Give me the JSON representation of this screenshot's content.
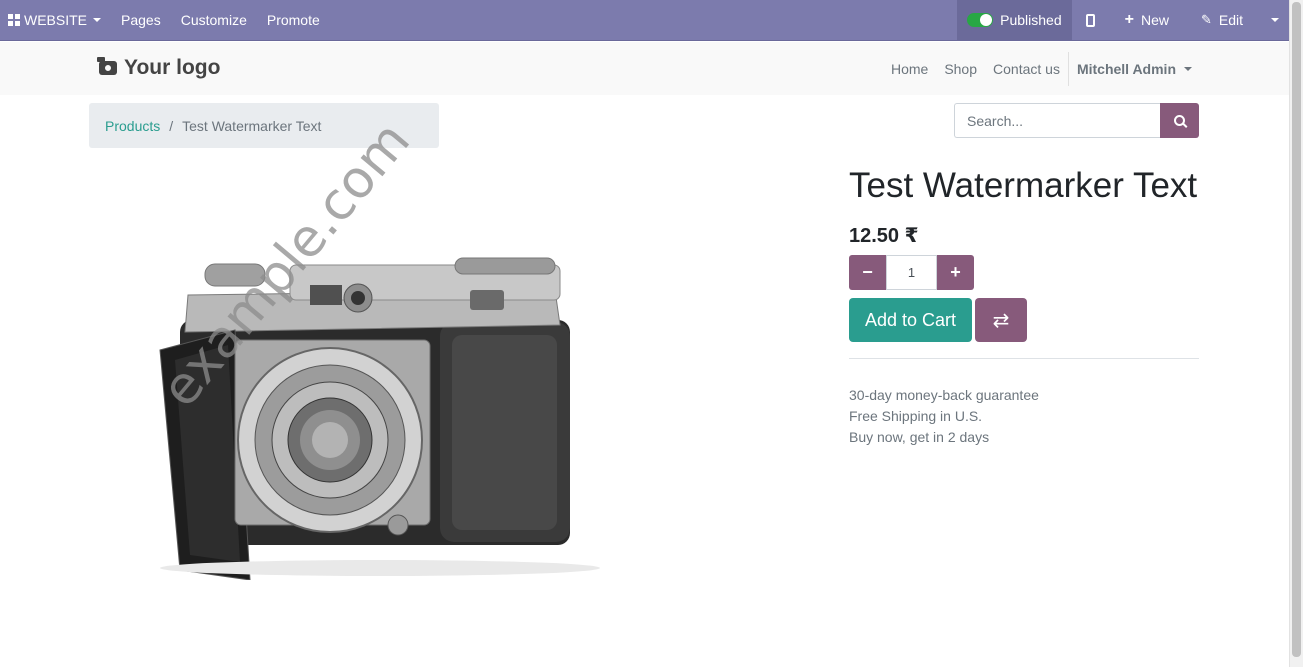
{
  "adminbar": {
    "website_label": "WEBSITE",
    "menu": [
      "Pages",
      "Customize",
      "Promote"
    ],
    "published_label": "Published",
    "new_label": "New",
    "edit_label": "Edit"
  },
  "header": {
    "logo_text": "Your logo",
    "nav": [
      "Home",
      "Shop",
      "Contact us"
    ],
    "user": "Mitchell Admin"
  },
  "breadcrumb": {
    "parent": "Products",
    "separator": "/",
    "current": "Test Watermarker Text"
  },
  "search": {
    "placeholder": "Search..."
  },
  "product": {
    "watermark": "example.com",
    "title": "Test Watermarker Text",
    "price": "12.50 ₹",
    "quantity": "1",
    "add_to_cart": "Add to Cart",
    "features": [
      "30-day money-back guarantee",
      "Free Shipping in U.S.",
      "Buy now, get in 2 days"
    ]
  },
  "colors": {
    "adminbar": "#7c7bad",
    "primary": "#875a7b",
    "accent": "#2a9d8f"
  }
}
